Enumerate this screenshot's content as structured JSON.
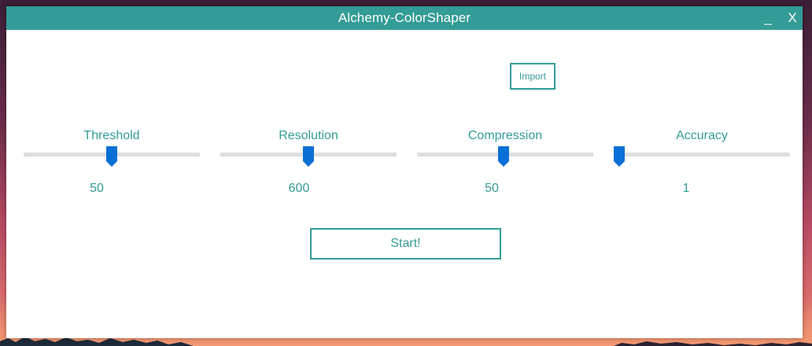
{
  "window": {
    "title": "Alchemy-ColorShaper",
    "minimize_label": "_",
    "close_label": "X"
  },
  "import_label": "Import",
  "sliders": [
    {
      "label": "Threshold",
      "value": "50",
      "fraction": 0.5
    },
    {
      "label": "Resolution",
      "value": "600",
      "fraction": 0.5
    },
    {
      "label": "Compression",
      "value": "50",
      "fraction": 0.49
    },
    {
      "label": "Accuracy",
      "value": "1",
      "fraction": 0.0
    }
  ],
  "start_label": "Start!",
  "colors": {
    "accent": "#339c96",
    "slider_thumb": "#0a6fd6",
    "slider_track": "#dddddd"
  }
}
